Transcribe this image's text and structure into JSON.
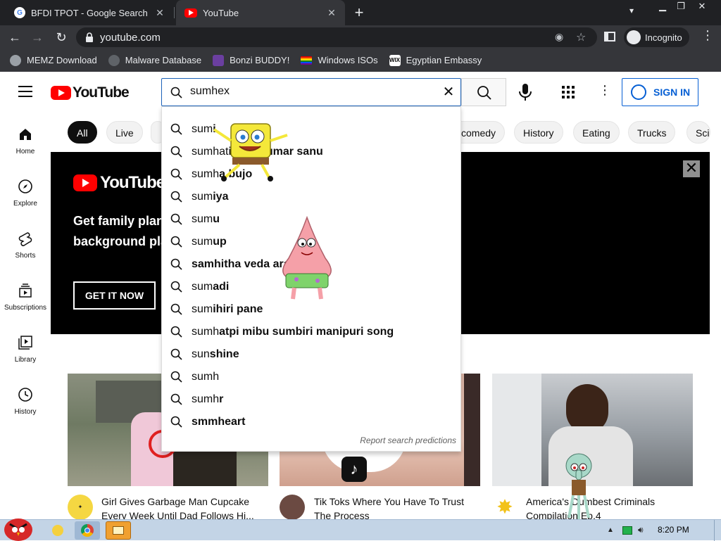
{
  "browser": {
    "tabs": [
      {
        "title": "BFDI TPOT - Google Search"
      },
      {
        "title": "YouTube"
      }
    ],
    "url": "youtube.com",
    "incognito_label": "Incognito",
    "bookmarks": [
      {
        "label": "MEMZ Download"
      },
      {
        "label": "Malware Database"
      },
      {
        "label": "Bonzi BUDDY!"
      },
      {
        "label": "Windows ISOs"
      },
      {
        "label": "Egyptian Embassy"
      }
    ]
  },
  "youtube": {
    "logo_text": "YouTube",
    "search_value": "sumhex",
    "sign_in": "SIGN IN",
    "guide": [
      {
        "label": "Home"
      },
      {
        "label": "Explore"
      },
      {
        "label": "Shorts"
      },
      {
        "label": "Subscriptions"
      },
      {
        "label": "Library"
      },
      {
        "label": "History"
      }
    ],
    "chips": [
      "All",
      "Live",
      "comedy",
      "History",
      "Eating",
      "Trucks",
      "Sci"
    ],
    "banner": {
      "logo_text": "YouTube M",
      "line1": "Get family plan",
      "line2": "background pla",
      "cta": "GET IT NOW"
    },
    "suggestions": [
      {
        "prefix": "sum",
        "rest": "i"
      },
      {
        "prefix": "sumhat",
        "rest": "i... se kumar sanu"
      },
      {
        "prefix": "sumh",
        "rest": "a bujo"
      },
      {
        "prefix": "sum",
        "rest": "iya"
      },
      {
        "prefix": "sum",
        "rest": "u"
      },
      {
        "prefix": "sum",
        "rest": "up"
      },
      {
        "prefix": "",
        "rest": "samhitha veda aradi"
      },
      {
        "prefix": "sum",
        "rest": "adi"
      },
      {
        "prefix": "sum",
        "rest": "ihiri pane"
      },
      {
        "prefix": "sumh",
        "rest": "atpi mibu sumbiri manipuri song"
      },
      {
        "prefix": "sun",
        "rest": "shine"
      },
      {
        "prefix": "sumh",
        "rest": ""
      },
      {
        "prefix": "sumh",
        "rest": "r"
      },
      {
        "prefix": "",
        "rest": "smmheart"
      }
    ],
    "report_text": "Report search predictions",
    "videos": [
      {
        "title1": "Girl Gives Garbage Man Cupcake",
        "title2": "Every Week Until Dad Follows Hi..."
      },
      {
        "title1": "Tik Toks Where You Have To Trust",
        "title2": "The Process"
      },
      {
        "title1": "America's Dumbest Criminals",
        "title2": "Compilation Ep.4"
      }
    ]
  },
  "taskbar": {
    "clock": "8:20 PM"
  },
  "colors": {
    "yt_red": "#ff0000",
    "link_blue": "#065fd4",
    "chrome_dark": "#202124"
  }
}
